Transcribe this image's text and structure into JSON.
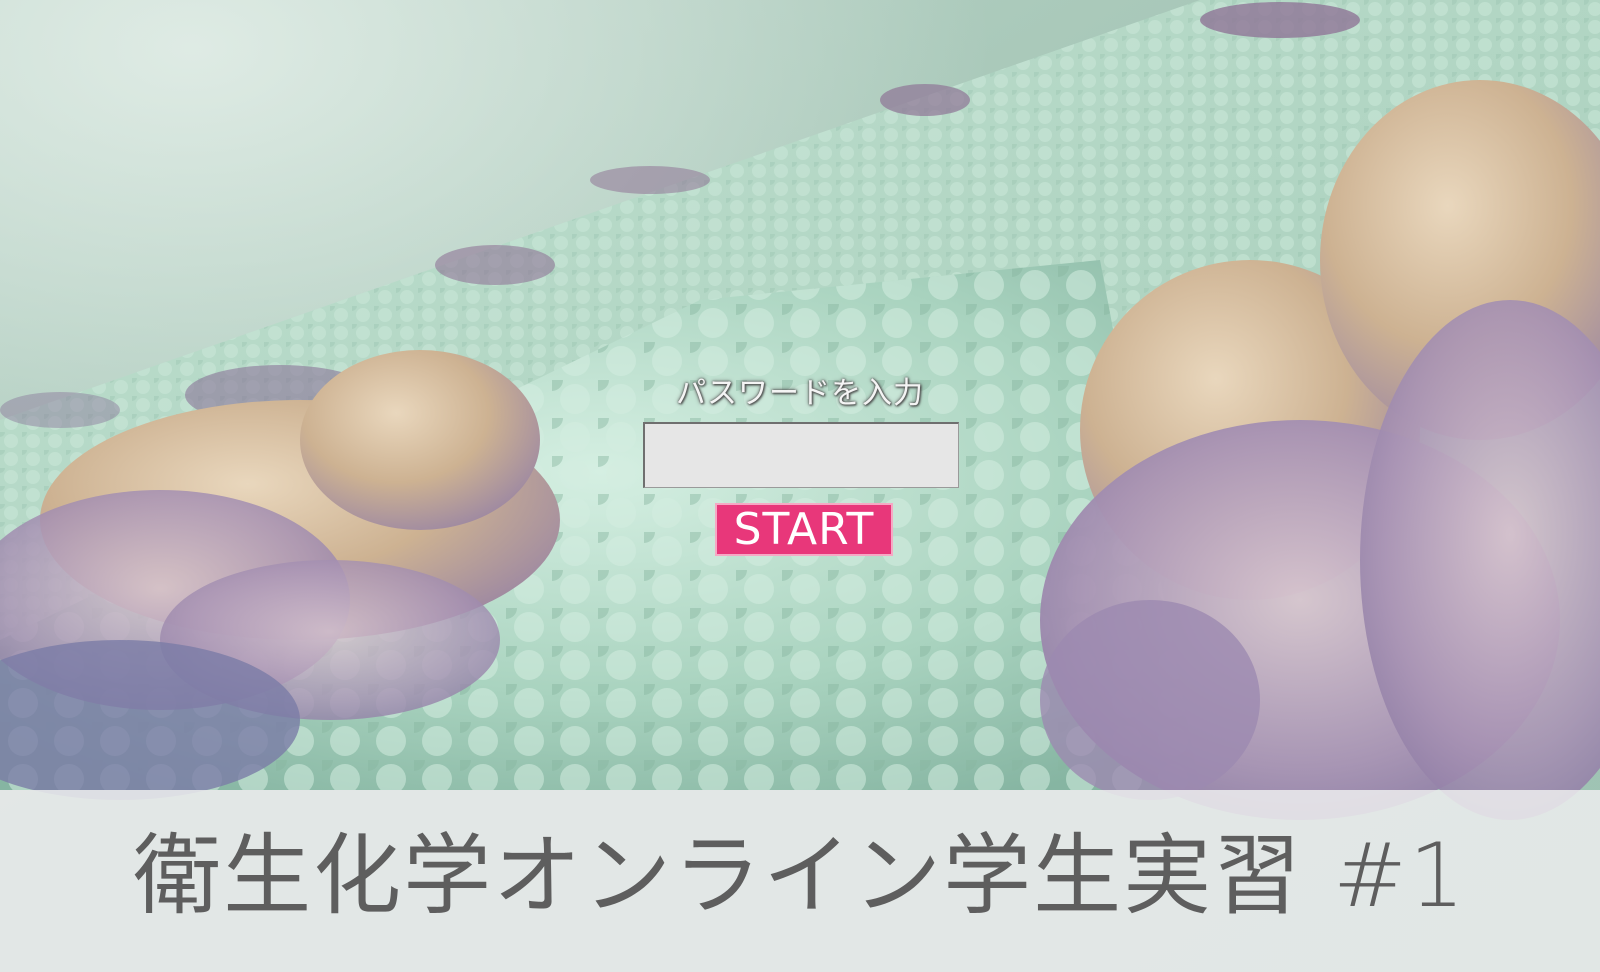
{
  "login": {
    "prompt_label": "パスワードを入力",
    "password_value": "",
    "password_placeholder": "",
    "start_label": "START"
  },
  "banner": {
    "title": "衛生化学オンライン学生実習 #1"
  },
  "colors": {
    "start_button": "#e8377a",
    "banner_bg": "#ececee",
    "title_text": "#5e5e5e"
  },
  "background": {
    "description_icon": "protein-membrane-illustration"
  }
}
